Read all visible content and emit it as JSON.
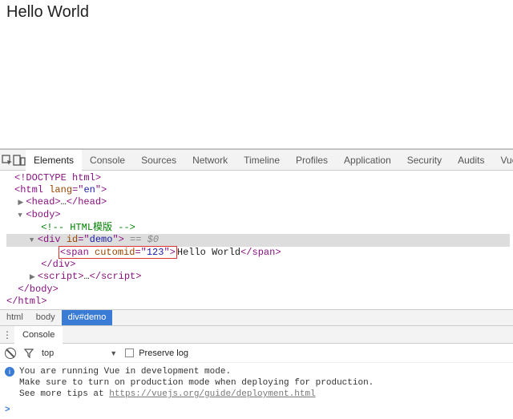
{
  "page": {
    "heading": "Hello World"
  },
  "devtools": {
    "tabs": [
      "Elements",
      "Console",
      "Sources",
      "Network",
      "Timeline",
      "Profiles",
      "Application",
      "Security",
      "Audits",
      "Vue"
    ],
    "activeTab": "Elements",
    "tree": {
      "doctype": "<!DOCTYPE html>",
      "html_open": "html",
      "html_attr_name": "lang",
      "html_attr_val": "en",
      "head_open": "head",
      "head_close": "/head",
      "head_ellipsis": "…",
      "body": "body",
      "comment": " HTML模版 ",
      "div_open": "div",
      "div_attr_name": "id",
      "div_attr_val": "demo",
      "eq0": " == $0",
      "span_open": "span",
      "span_attr_name": "cutomid",
      "span_attr_val": "123",
      "span_text": "Hello World",
      "span_close": "/span",
      "div_close": "/div",
      "script_open": "script",
      "script_close": "/script",
      "script_ellipsis": "…",
      "body_close": "/body",
      "html_close": "/html"
    },
    "crumbs": [
      "html",
      "body",
      "div#demo"
    ]
  },
  "console": {
    "tabLabel": "Console",
    "context": "top",
    "preserveLabel": "Preserve log",
    "preserveChecked": false,
    "message": {
      "line1": "You are running Vue in development mode.",
      "line2": "Make sure to turn on production mode when deploying for production.",
      "line3_prefix": "See more tips at ",
      "line3_link": "https://vuejs.org/guide/deployment.html"
    },
    "prompt": ">"
  }
}
